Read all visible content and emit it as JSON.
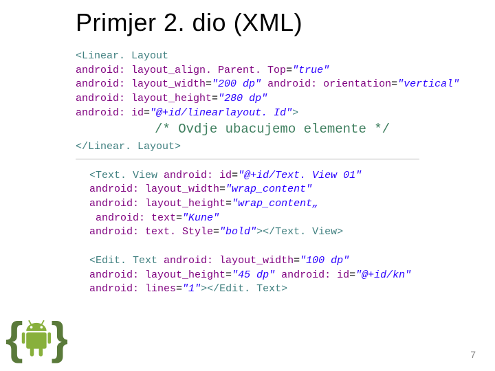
{
  "title": "Primjer 2. dio (XML)",
  "code1": {
    "l1a": "<",
    "l1tag": "Linear. Layout",
    "l2attr": "android: layout_align. Parent. Top",
    "l2eq": "=",
    "l2val": "\"true\"",
    "l3attr1": "android: layout_width",
    "l3eq1": "=",
    "l3val1": "\"200 dp\" ",
    "l3attr2": "android: orientation",
    "l3eq2": "=",
    "l3val2": "\"vertical\"",
    "l4attr": "android: layout_height",
    "l4eq": "=",
    "l4val": "\"280 dp\"",
    "l5attr": "android: id",
    "l5eq": "=",
    "l5val": "\"@+id/linearlayout. Id\"",
    "l5end": ">",
    "comment": "/* Ovdje ubacujemo elemente */",
    "close_a": "</",
    "close_tag": "Linear. Layout",
    "close_b": ">"
  },
  "code2": {
    "t1a": "<",
    "t1tag": "Text. View ",
    "t1attr": "android: id",
    "t1eq": "=",
    "t1val": "\"@+id/Text. View 01\"",
    "t2attr": "android: layout_width",
    "t2eq": "=",
    "t2val": "\"wrap_content\"",
    "t3attr": "android: layout_height",
    "t3eq": "=",
    "t3val": "\"wrap_content„",
    "t4attr": " android: text",
    "t4eq": "=",
    "t4val": "\"Kune\"",
    "t5attr": "android: text. Style",
    "t5eq": "=",
    "t5val": "\"bold\"",
    "t5c1": "></",
    "t5ctag": "Text. View",
    "t5c2": ">",
    "e1a": "<",
    "e1tag": "Edit. Text ",
    "e1attr": "android: layout_width",
    "e1eq": "=",
    "e1val": "\"100 dp\"",
    "e2attr1": "android: layout_height",
    "e2eq1": "=",
    "e2val1": "\"45 dp\" ",
    "e2attr2": "android: id",
    "e2eq2": "=",
    "e2val2": "\"@+id/kn\"",
    "e3attr": "android: lines",
    "e3eq": "=",
    "e3val": "\"1\"",
    "e3c1": "></",
    "e3ctag": "Edit. Text",
    "e3c2": ">"
  },
  "pagenum": "7"
}
